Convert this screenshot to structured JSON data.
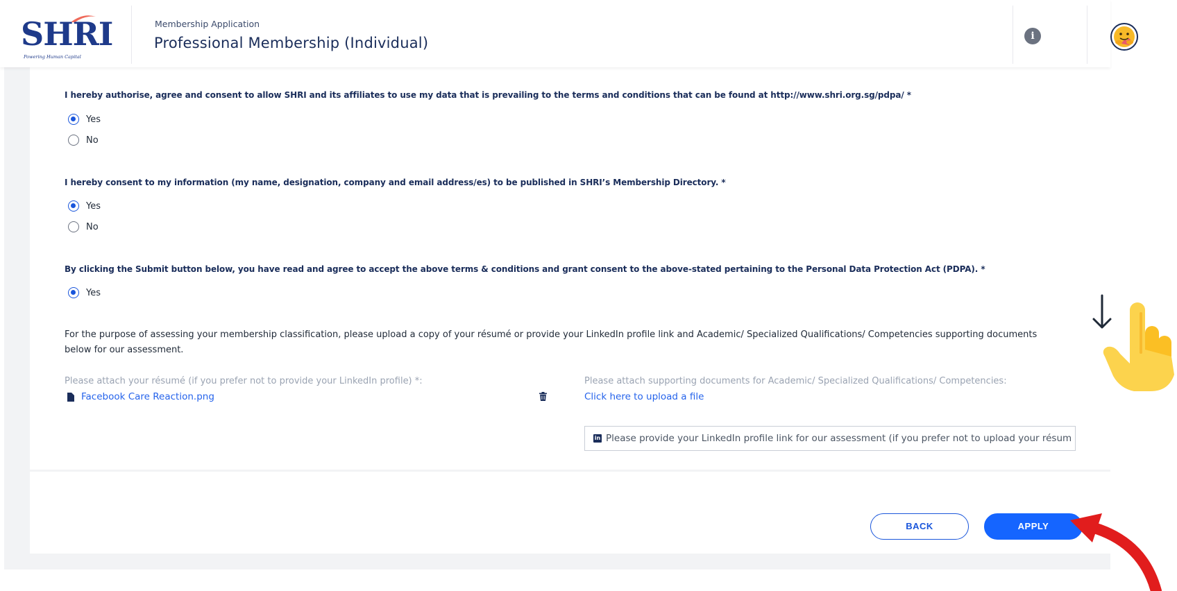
{
  "brand": {
    "logo_text": "SHRI",
    "logo_tagline": "Powering Human Capital"
  },
  "header": {
    "subtitle": "Membership Application",
    "title": "Professional Membership (Individual)",
    "info_glyph": "i"
  },
  "consents": [
    {
      "question": "I hereby authorise, agree and consent to allow SHRI and its affiliates to use my data that is prevailing to the terms and conditions that can be found at http://www.shri.org.sg/pdpa/ *",
      "options": [
        {
          "label": "Yes",
          "selected": true
        },
        {
          "label": "No",
          "selected": false
        }
      ]
    },
    {
      "question": "I hereby consent to my information (my name, designation, company and email address/es) to be published in SHRI’s Membership Directory. *",
      "options": [
        {
          "label": "Yes",
          "selected": true
        },
        {
          "label": "No",
          "selected": false
        }
      ]
    },
    {
      "question": "By clicking the Submit button below, you have read and agree to accept the above terms & conditions and grant consent to the above-stated pertaining to the Personal Data Protection Act (PDPA). *",
      "options": [
        {
          "label": "Yes",
          "selected": true
        }
      ]
    }
  ],
  "assessment": {
    "instructions": "For the purpose of assessing your membership classification, please upload a copy of your résumé or provide your LinkedIn profile link and Academic/ Specialized Qualifications/ Competencies supporting documents below for our assessment.",
    "resume_label": "Please attach your résumé (if you prefer not to provide your LinkedIn profile) *:",
    "resume_file": "Facebook Care Reaction.png",
    "supporting_label": "Please attach supporting documents for Academic/ Specialized Qualifications/ Competencies:",
    "upload_link": "Click here to upload a file",
    "linkedin_placeholder": "Please provide your LinkedIn profile link for our assessment (if you prefer not to upload your résum",
    "linkedin_glyph": "in"
  },
  "actions": {
    "back_label": "BACK",
    "apply_label": "APPLY"
  },
  "colors": {
    "accent": "#1565ff",
    "navy": "#1a2d5a",
    "link": "#2563eb",
    "annotation_red": "#e11d1d",
    "hand_yellow": "#fcd34d"
  }
}
